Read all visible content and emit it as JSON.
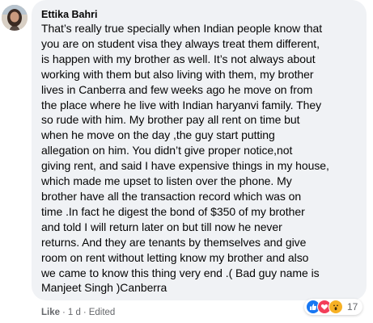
{
  "comment": {
    "author": "Ettika Bahri",
    "text": "That’s really true specially when Indian people know that\nyou are on student visa they always treat them different,\nis happen with my brother as well. It’s not always about\nworking with them but also living with them, my brother\nlives in Canberra and few weeks ago he move on from\nthe place where he live with Indian haryanvi family. They\nso rude with him. My brother pay all rent on time but\nwhen he move on the day ,the guy start putting\nallegation on him. You didn’t give proper notice,not\ngiving rent, and said I have expensive things in my house,\nwhich made me upset to listen over the phone. My\nbrother have all the transaction record which was on\ntime .In fact he digest the bond of $350 of my brother\nand told I will return later on but till now he never\nreturns. And they are tenants by themselves and give\nroom on rent without letting know my brother and also\nwe came to know this thing very end .( Bad guy name is\nManjeet Singh )Canberra"
  },
  "actions": {
    "like_label": "Like",
    "separator": "·",
    "time": "1 d",
    "edited": "Edited"
  },
  "reactions": {
    "icons": [
      "like-icon",
      "love-icon",
      "wow-icon"
    ],
    "count": "17",
    "colors": {
      "like": "#1877f2",
      "love": "#f33e58",
      "wow": "#f7b125"
    }
  },
  "colors": {
    "bubble": "#f0f2f5",
    "text": "#050505",
    "meta": "#65676b"
  }
}
